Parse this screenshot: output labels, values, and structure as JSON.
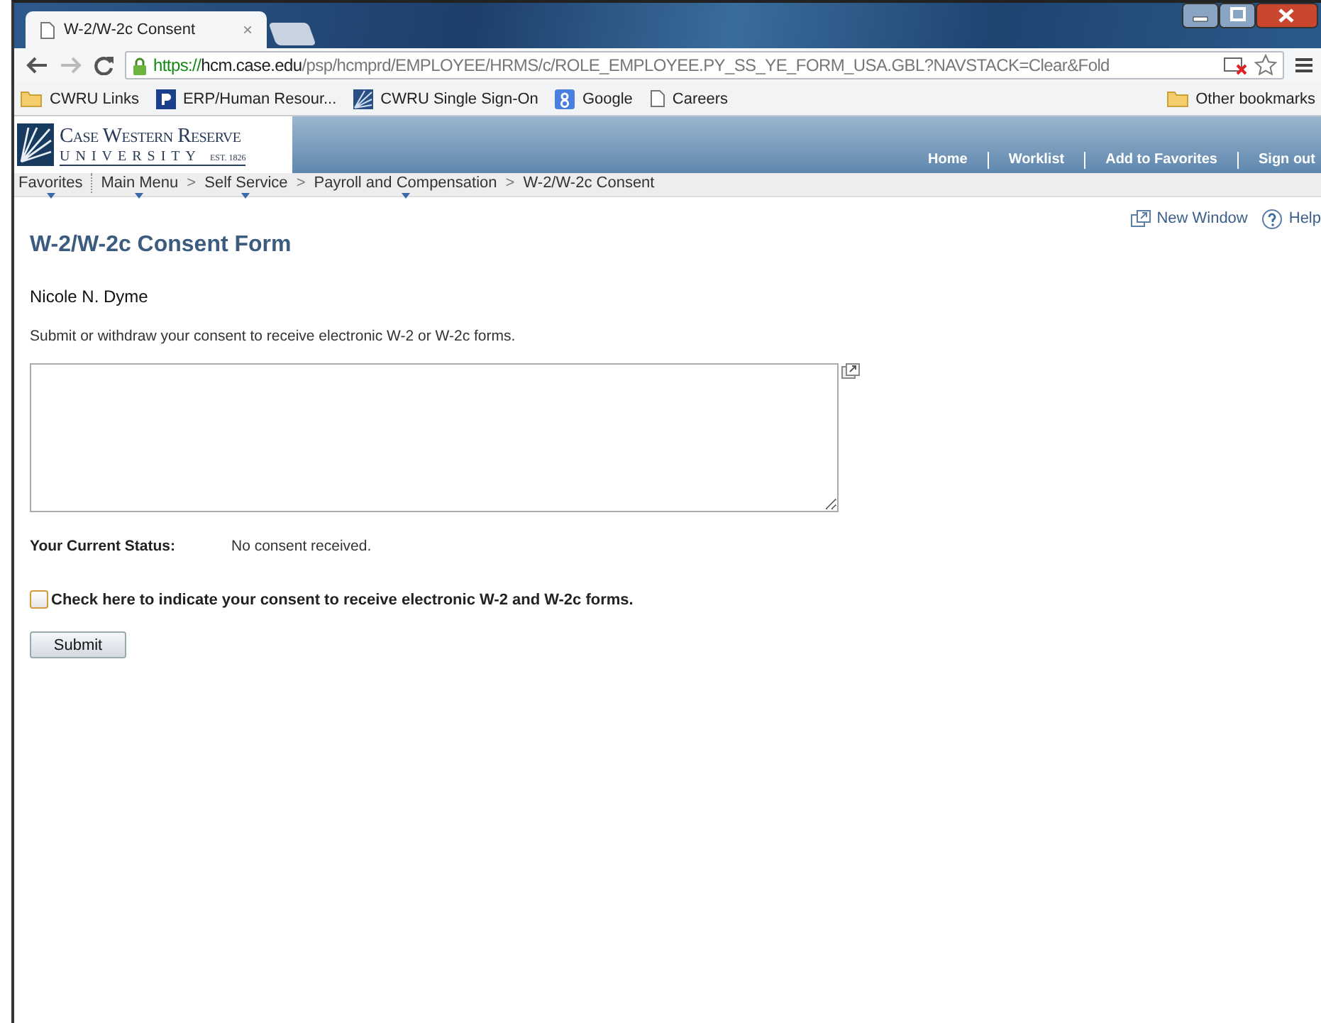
{
  "browser": {
    "tab": {
      "title": "W-2/W-2c Consent",
      "close": "×",
      "selected": true
    },
    "url": {
      "scheme": "https://",
      "host": "hcm.case.edu",
      "path": "/psp/hcmprd/EMPLOYEE/HRMS/c/ROLE_EMPLOYEE.PY_SS_YE_FORM_USA.GBL?NAVSTACK=Clear&Fold"
    },
    "bookmarks": [
      {
        "kind": "folder",
        "label": "CWRU Links"
      },
      {
        "kind": "p-logo",
        "label": "ERP/Human Resour..."
      },
      {
        "kind": "tile",
        "label": "CWRU Single Sign-On"
      },
      {
        "kind": "google",
        "label": "Google"
      },
      {
        "kind": "page",
        "label": "Careers"
      }
    ],
    "other_bookmarks": "Other bookmarks"
  },
  "header": {
    "logo": {
      "line_1": "Case Western Reserve",
      "line_2": "UNIVERSITY",
      "est": "EST. 1826"
    },
    "links": [
      "Home",
      "Worklist",
      "Add to Favorites",
      "Sign out"
    ]
  },
  "breadcrumb": [
    {
      "kind": "link",
      "label": "Favorites",
      "menu": true
    },
    {
      "kind": "divider"
    },
    {
      "kind": "link",
      "label": "Main Menu",
      "menu": true
    },
    {
      "kind": "separator",
      "label": ">"
    },
    {
      "kind": "link",
      "label": "Self Service",
      "menu": true
    },
    {
      "kind": "separator",
      "label": ">"
    },
    {
      "kind": "link",
      "label": "Payroll and Compensation",
      "menu": true
    },
    {
      "kind": "separator",
      "label": ">"
    },
    {
      "kind": "link",
      "label": "W-2/W-2c Consent",
      "menu": false
    }
  ],
  "page_links": [
    "New Window",
    "Help"
  ],
  "form": {
    "title": "W-2/W-2c Consent Form",
    "employee_name": "Nicole N. Dyme",
    "description": "Submit or withdraw your consent to receive electronic W-2 or W-2c forms.",
    "status_label": "Your Current Status:",
    "status_value": "No consent received.",
    "consent": {
      "label": "Check here to indicate your consent to receive electronic W-2 and W-2c forms.",
      "checked": false
    },
    "submit": "Submit"
  }
}
